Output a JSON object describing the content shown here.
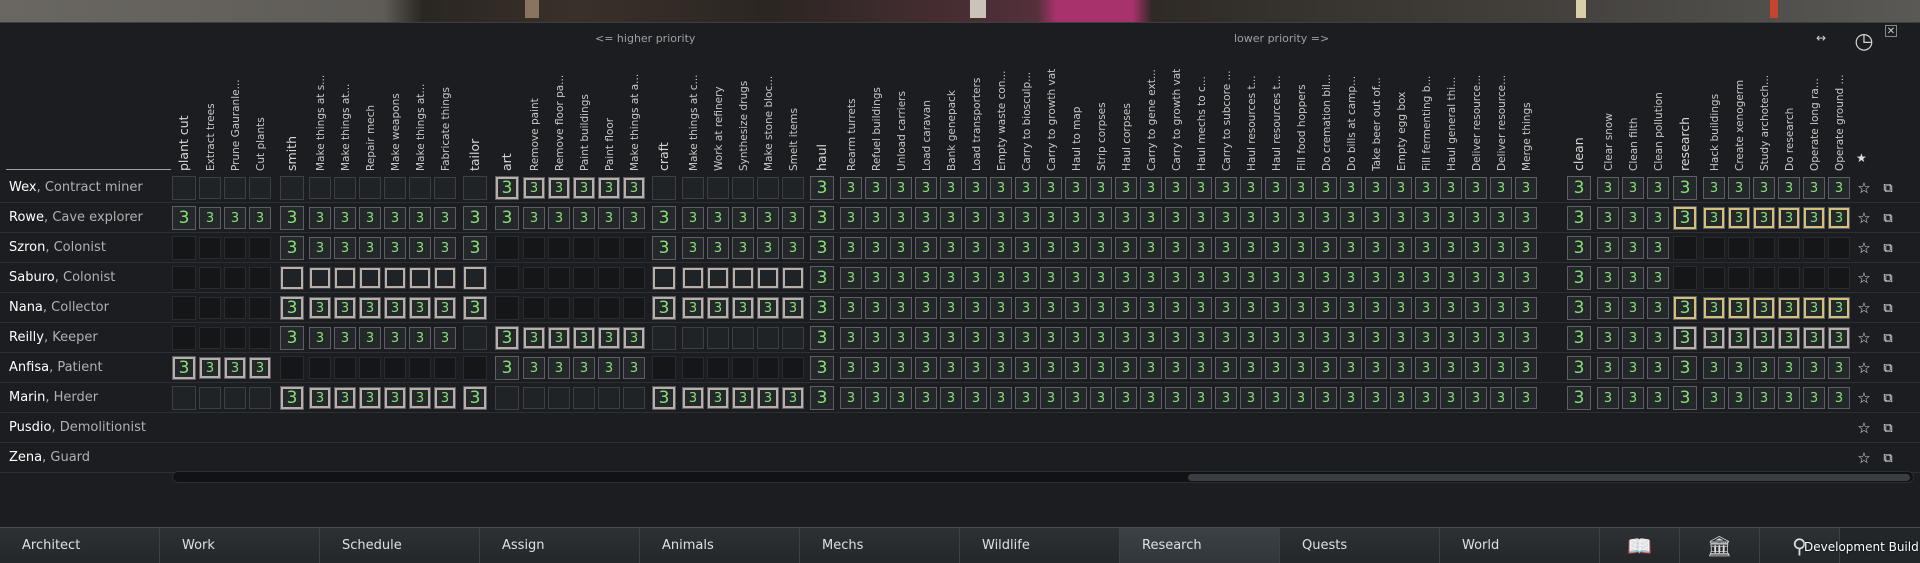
{
  "window": {
    "higher_priority_hint": "<= higher priority",
    "lower_priority_hint": "lower priority =>",
    "star_column_symbol": "★"
  },
  "icons": {
    "collapse": "↔",
    "clock": "◷",
    "close": "✕",
    "favorite": "☆",
    "info_card": "⧉"
  },
  "colors": {
    "priority_text": "#86e078",
    "panel_bg": "#1b1d20",
    "active_tab": "#3b4146"
  },
  "columns": [
    {
      "label": "plant cut",
      "major": true
    },
    {
      "label": "Extract trees",
      "major": false
    },
    {
      "label": "Prune Gauranle...",
      "major": false
    },
    {
      "label": "Cut plants",
      "major": false
    },
    {
      "label": "smith",
      "major": true
    },
    {
      "label": "Make things at s...",
      "major": false
    },
    {
      "label": "Make things at...",
      "major": false
    },
    {
      "label": "Repair mech",
      "major": false
    },
    {
      "label": "Make weapons",
      "major": false
    },
    {
      "label": "Make things at...",
      "major": false
    },
    {
      "label": "Fabricate things",
      "major": false
    },
    {
      "label": "tailor",
      "major": true
    },
    {
      "label": "art",
      "major": true
    },
    {
      "label": "Remove paint",
      "major": false
    },
    {
      "label": "Remove floor pa...",
      "major": false
    },
    {
      "label": "Paint buildings",
      "major": false
    },
    {
      "label": "Paint floor",
      "major": false
    },
    {
      "label": "Make things at a...",
      "major": false
    },
    {
      "label": "craft",
      "major": true
    },
    {
      "label": "Make things at c...",
      "major": false
    },
    {
      "label": "Work at refinery",
      "major": false
    },
    {
      "label": "Synthesize drugs",
      "major": false
    },
    {
      "label": "Make stone bloc...",
      "major": false
    },
    {
      "label": "Smelt items",
      "major": false
    },
    {
      "label": "haul",
      "major": true
    },
    {
      "label": "Rearm turrets",
      "major": false
    },
    {
      "label": "Refuel buildings",
      "major": false
    },
    {
      "label": "Unload carriers",
      "major": false
    },
    {
      "label": "Load caravan",
      "major": false
    },
    {
      "label": "Bank genepack",
      "major": false
    },
    {
      "label": "Load transporters",
      "major": false
    },
    {
      "label": "Empty waste con...",
      "major": false
    },
    {
      "label": "Carry to biosculp...",
      "major": false
    },
    {
      "label": "Carry to growth vat",
      "major": false
    },
    {
      "label": "Haul to map",
      "major": false
    },
    {
      "label": "Strip corpses",
      "major": false
    },
    {
      "label": "Haul corpses",
      "major": false
    },
    {
      "label": "Carry to gene ext...",
      "major": false
    },
    {
      "label": "Carry to growth vat",
      "major": false
    },
    {
      "label": "Haul mechs to c...",
      "major": false
    },
    {
      "label": "Carry to subcore ...",
      "major": false
    },
    {
      "label": "Haul resources t...",
      "major": false
    },
    {
      "label": "Haul resources t...",
      "major": false
    },
    {
      "label": "Fill food hoppers",
      "major": false
    },
    {
      "label": "Do cremation bil...",
      "major": false
    },
    {
      "label": "Do bills at camp...",
      "major": false
    },
    {
      "label": "Take beer out of...",
      "major": false
    },
    {
      "label": "Empty egg box",
      "major": false
    },
    {
      "label": "Fill fermenting b...",
      "major": false
    },
    {
      "label": "Haul general thi...",
      "major": false
    },
    {
      "label": "Deliver resource...",
      "major": false
    },
    {
      "label": "Deliver resource...",
      "major": false
    },
    {
      "label": "Merge things",
      "major": false
    },
    {
      "label": "clean",
      "major": true
    },
    {
      "label": "Clear snow",
      "major": false
    },
    {
      "label": "Clean filth",
      "major": false
    },
    {
      "label": "Clean pollution",
      "major": false
    },
    {
      "label": "research",
      "major": true
    },
    {
      "label": "Hack buildings",
      "major": false
    },
    {
      "label": "Create xenogerm",
      "major": false
    },
    {
      "label": "Study archotech...",
      "major": false
    },
    {
      "label": "Do research",
      "major": false
    },
    {
      "label": "Operate long ra...",
      "major": false
    },
    {
      "label": "Operate ground ...",
      "major": false
    }
  ],
  "pawns": [
    {
      "name": "Wex",
      "title": "Contract miner",
      "groups": {
        "plant": "empty",
        "smith": "empty",
        "tailor": "empty",
        "art": "3h",
        "craft": "empty",
        "rest": "3",
        "research": "3"
      }
    },
    {
      "name": "Rowe",
      "title": "Cave explorer",
      "groups": {
        "plant": "3",
        "smith": "3",
        "tailor": "3",
        "art": "3",
        "craft": "3",
        "rest": "3",
        "research": "3g"
      }
    },
    {
      "name": "Szron",
      "title": "Colonist",
      "groups": {
        "plant": "disabled",
        "smith": "3",
        "tailor": "3",
        "art": "disabled",
        "craft": "3",
        "rest": "3",
        "research": "disabled"
      }
    },
    {
      "name": "Saburo",
      "title": "Colonist",
      "groups": {
        "plant": "disabled",
        "smith": "emptyh",
        "tailor": "emptyh",
        "art": "disabled",
        "craft": "emptyh",
        "rest": "3",
        "research": "disabled"
      }
    },
    {
      "name": "Nana",
      "title": "Collector",
      "groups": {
        "plant": "disabled",
        "smith": "3h",
        "tailor": "3h",
        "art": "disabled",
        "craft": "3h",
        "rest": "3",
        "research": "3g"
      }
    },
    {
      "name": "Reilly",
      "title": "Keeper",
      "groups": {
        "plant": "disabled",
        "smith": "3",
        "tailor": "empty",
        "art": "3h",
        "craft": "empty",
        "rest": "3",
        "research": "3h"
      }
    },
    {
      "name": "Anfisa",
      "title": "Patient",
      "groups": {
        "plant": "3h",
        "smith": "disabled",
        "tailor": "disabled",
        "art": "3",
        "craft": "disabled",
        "rest": "3",
        "research": "3"
      }
    },
    {
      "name": "Marin",
      "title": "Herder",
      "groups": {
        "plant": "empty",
        "smith": "3h",
        "tailor": "3h",
        "art": "empty",
        "craft": "3h",
        "rest": "3",
        "research": "3"
      }
    },
    {
      "name": "Pusdio",
      "title": "Demolitionist",
      "groups": {
        "plant": "none",
        "smith": "none",
        "tailor": "none",
        "art": "none",
        "craft": "none",
        "rest": "none",
        "research": "none"
      }
    },
    {
      "name": "Zena",
      "title": "Guard",
      "groups": {
        "plant": "none",
        "smith": "none",
        "tailor": "none",
        "art": "none",
        "craft": "none",
        "rest": "none",
        "research": "none"
      }
    }
  ],
  "priority_value": "3",
  "main_tabs": [
    {
      "label": "Architect",
      "active": false
    },
    {
      "label": "Work",
      "active": false
    },
    {
      "label": "Schedule",
      "active": false
    },
    {
      "label": "Assign",
      "active": false
    },
    {
      "label": "Animals",
      "active": false
    },
    {
      "label": "Mechs",
      "active": false
    },
    {
      "label": "Wildlife",
      "active": false
    },
    {
      "label": "Research",
      "active": true
    },
    {
      "label": "Quests",
      "active": false
    },
    {
      "label": "World",
      "active": false
    }
  ],
  "tab_icons": [
    {
      "name": "history-icon",
      "glyph": "📖"
    },
    {
      "name": "factions-icon",
      "glyph": "🏛"
    },
    {
      "name": "ideology-icon",
      "glyph": "⚲"
    }
  ],
  "dev_build_label": "Development Build"
}
